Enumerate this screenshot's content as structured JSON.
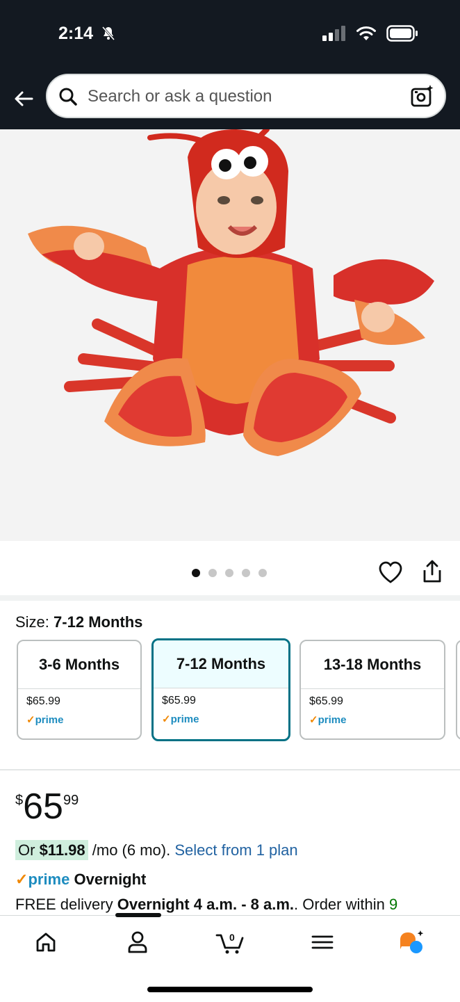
{
  "status": {
    "time": "2:14"
  },
  "search": {
    "placeholder": "Search or ask a question"
  },
  "carousel": {
    "count": 5,
    "active": 0
  },
  "size": {
    "label": "Size:",
    "selected": "7-12 Months",
    "options": [
      {
        "label": "3-6 Months",
        "price": "$65.99",
        "prime": "prime"
      },
      {
        "label": "7-12 Months",
        "price": "$65.99",
        "prime": "prime"
      },
      {
        "label": "13-18 Months",
        "price": "$65.99",
        "prime": "prime"
      }
    ]
  },
  "price": {
    "currency": "$",
    "whole": "65",
    "fraction": "99"
  },
  "monthly": {
    "amount_prefix": "Or ",
    "amount": "$11.98",
    "term": " /mo (6 mo). ",
    "link": "Select from 1 plan"
  },
  "shipping": {
    "prime_word": "prime",
    "speed": "Overnight"
  },
  "delivery": {
    "prefix": "FREE delivery ",
    "window": "Overnight 4 a.m. - 8 a.m.",
    "suffix": ". Order within ",
    "countdown": "9"
  },
  "colors": {
    "header": "#131921",
    "selected_border": "#007185",
    "link": "#2162a1",
    "prime_blue": "#1d8cbf",
    "prime_check": "#f08804"
  }
}
